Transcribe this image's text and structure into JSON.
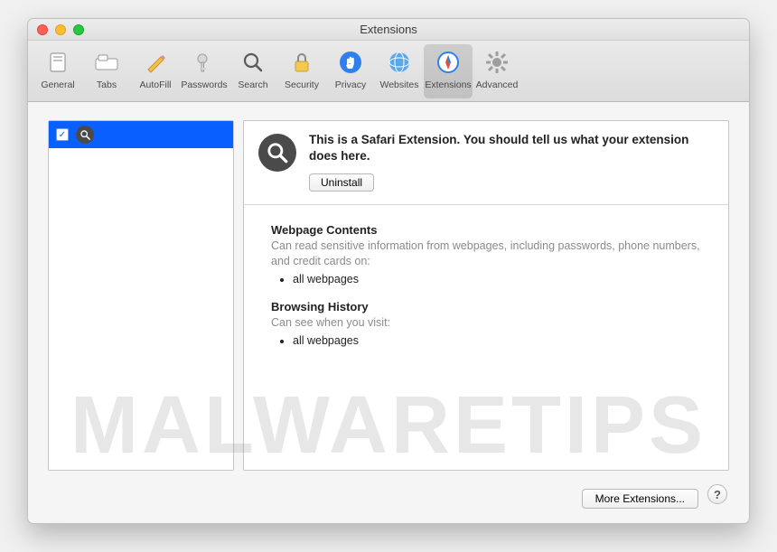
{
  "window": {
    "title": "Extensions"
  },
  "toolbar": {
    "items": [
      {
        "label": "General"
      },
      {
        "label": "Tabs"
      },
      {
        "label": "AutoFill"
      },
      {
        "label": "Passwords"
      },
      {
        "label": "Search"
      },
      {
        "label": "Security"
      },
      {
        "label": "Privacy"
      },
      {
        "label": "Websites"
      },
      {
        "label": "Extensions"
      },
      {
        "label": "Advanced"
      }
    ]
  },
  "sidebar": {
    "items": [
      {
        "checked": true,
        "icon": "search"
      }
    ]
  },
  "detail": {
    "title": "This is a Safari Extension. You should tell us what your extension does here.",
    "uninstall_label": "Uninstall",
    "sections": [
      {
        "title": "Webpage Contents",
        "desc": "Can read sensitive information from webpages, including passwords, phone numbers, and credit cards on:",
        "bullets": [
          "all webpages"
        ]
      },
      {
        "title": "Browsing History",
        "desc": "Can see when you visit:",
        "bullets": [
          "all webpages"
        ]
      }
    ]
  },
  "footer": {
    "more_label": "More Extensions...",
    "help_label": "?"
  },
  "watermark": "MALWARETIPS"
}
